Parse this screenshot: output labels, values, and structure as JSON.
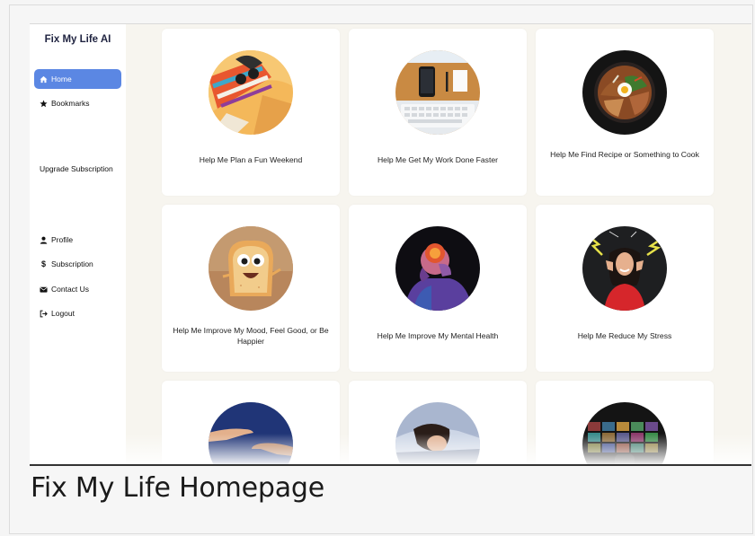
{
  "sidebar": {
    "brand": "Fix My Life AI",
    "nav": [
      {
        "label": "Home",
        "icon": "home-icon",
        "active": true
      },
      {
        "label": "Bookmarks",
        "icon": "star-icon"
      }
    ],
    "upgrade_label": "Upgrade Subscription",
    "account": [
      {
        "label": "Profile",
        "icon": "user-icon"
      },
      {
        "label": "Subscription",
        "icon": "dollar-icon"
      },
      {
        "label": "Contact Us",
        "icon": "envelope-icon"
      },
      {
        "label": "Logout",
        "icon": "logout-icon"
      }
    ]
  },
  "cards": [
    {
      "label": "Help Me Plan a Fun Weekend",
      "image": "beach-weekend"
    },
    {
      "label": "Help Me Get My Work Done Faster",
      "image": "desk-workspace"
    },
    {
      "label": "Help Me Find Recipe or Something to Cook",
      "image": "food-bowl"
    },
    {
      "label": "Help Me Improve My Mood, Feel Good, or Be Happier",
      "image": "happy-toast"
    },
    {
      "label": "Help Me Improve My Mental Health",
      "image": "stressed-person-glow"
    },
    {
      "label": "Help Me Reduce My Stress",
      "image": "stressed-woman-chalkboard"
    },
    {
      "label": "",
      "image": "reaching-hands"
    },
    {
      "label": "",
      "image": "woman-sleeping"
    },
    {
      "label": "",
      "image": "tv-remote"
    }
  ],
  "page_caption": "Fix My Life Homepage",
  "colors": {
    "accent": "#5b87e3",
    "background": "#f7f5ef",
    "card": "#ffffff"
  }
}
